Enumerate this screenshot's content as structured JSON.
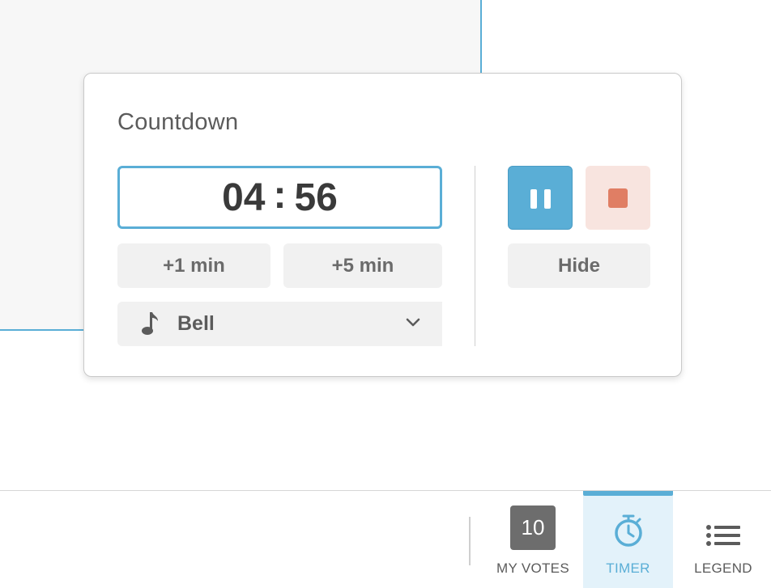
{
  "countdown": {
    "title": "Countdown",
    "time": {
      "minutes": "04",
      "separator": ":",
      "seconds": "56"
    },
    "add_one_label": "+1 min",
    "add_five_label": "+5 min",
    "sound": {
      "selected": "Bell",
      "icon": "music-note-icon"
    },
    "hide_label": "Hide",
    "pause_icon": "pause-icon",
    "stop_icon": "stop-icon"
  },
  "toolbar": {
    "votes": {
      "count": "10",
      "label": "MY VOTES"
    },
    "timer": {
      "label": "TIMER",
      "icon": "stopwatch-icon",
      "active": true
    },
    "legend": {
      "label": "LEGEND",
      "icon": "list-icon"
    }
  },
  "colors": {
    "accent": "#5aaed6",
    "stop": "#e07e64",
    "stop_bg": "#f8e4df",
    "active_tab_bg": "#e3f2fa",
    "badge": "#6d6d6d"
  }
}
